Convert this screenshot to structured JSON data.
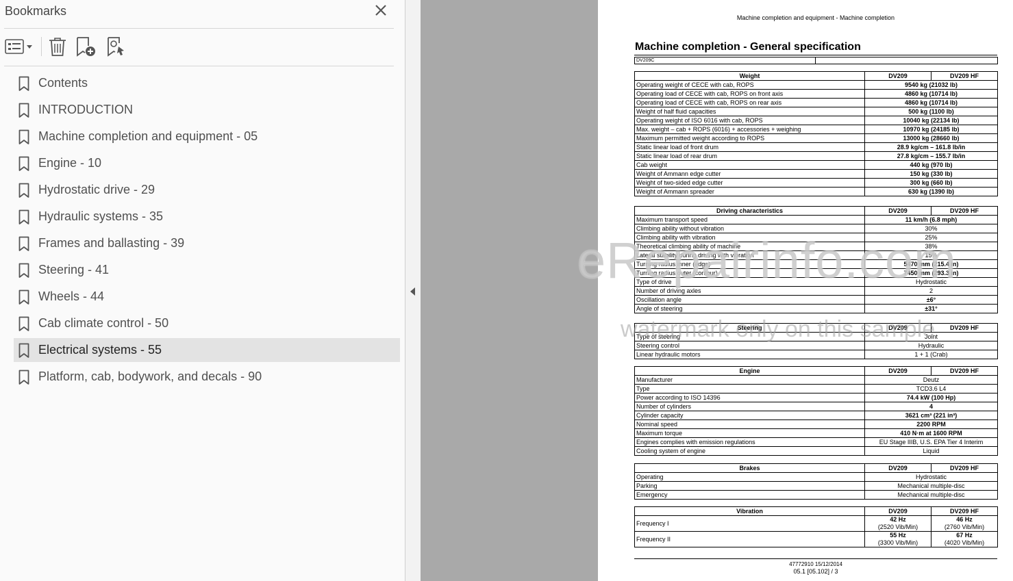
{
  "panel": {
    "title": "Bookmarks",
    "bookmarks": [
      "Contents",
      "INTRODUCTION",
      "Machine completion and equipment - 05",
      "Engine - 10",
      "Hydrostatic drive - 29",
      "Hydraulic systems - 35",
      "Frames and ballasting - 39",
      "Steering - 41",
      "Wheels - 44",
      "Cab climate control - 50",
      "Electrical systems - 55",
      "Platform, cab, bodywork, and decals - 90"
    ],
    "selected_index": 10,
    "icons": [
      "options-menu-icon",
      "trash-icon",
      "add-bookmark-icon",
      "find-bookmark-icon",
      "close-icon",
      "collapse-arrow-icon",
      "bookmark-icon"
    ]
  },
  "doc": {
    "header": "Machine completion and equipment - Machine completion",
    "title": "Machine completion - General specification",
    "code": "DV209C",
    "col1": "DV209",
    "col2": "DV209 HF",
    "weight": {
      "heading": "Weight",
      "rows": [
        [
          "Operating weight of CECE with cab, ROPS",
          "9540 kg (21032 lb)"
        ],
        [
          "Operating load of CECE with cab, ROPS on front axis",
          "4860 kg (10714 lb)"
        ],
        [
          "Operating load of CECE with cab, ROPS on rear axis",
          "4860 kg (10714 lb)"
        ],
        [
          "Weight of half fluid capacities",
          "500 kg (1100 lb)"
        ],
        [
          "Operating weight of ISO 6016 with cab, ROPS",
          "10040 kg (22134 lb)"
        ],
        [
          "Max. weight – cab + ROPS (6016) + accessories + weighing",
          "10970 kg (24185 lb)"
        ],
        [
          "Maximum permitted weight according to ROPS",
          "13000 kg (28660 lb)"
        ],
        [
          "Static linear load of front drum",
          "28.9 kg/cm – 161.8 lb/in"
        ],
        [
          "Static linear load of rear drum",
          "27.8 kg/cm – 155.7 lb/in"
        ],
        [
          "Cab weight",
          "440 kg (970 lb)"
        ],
        [
          "Weight of Ammann edge cutter",
          "150 kg (330 lb)"
        ],
        [
          "Weight of two-sided edge cutter",
          "300 kg (660 lb)"
        ],
        [
          "Weight of Ammann spreader",
          "630 kg (1390 lb)"
        ]
      ]
    },
    "driving": {
      "heading": "Driving characteristics",
      "rows": [
        [
          "Maximum transport speed",
          "11 km/h (6.8 mph)",
          true
        ],
        [
          "Climbing ability without vibration",
          "30%",
          false
        ],
        [
          "Climbing ability with vibration",
          "25%",
          false
        ],
        [
          "Theoretical climbing ability of machine",
          "38%",
          false
        ],
        [
          "Lateral stability during driving with vibration",
          "15%",
          false
        ],
        [
          "Turning radius inner (edge)",
          "5470 mm (215.4 in)",
          true
        ],
        [
          "Turning radius outer (contour)",
          "7450 mm (293.3 in)",
          true
        ],
        [
          "Type of drive",
          "Hydrostatic",
          false
        ],
        [
          "Number of driving axles",
          "2",
          false
        ],
        [
          "Oscillation angle",
          "±6°",
          true
        ],
        [
          "Angle of steering",
          "±31°",
          true
        ]
      ]
    },
    "steering": {
      "heading": "Steering",
      "rows": [
        [
          "Type of steering",
          "Joint"
        ],
        [
          "Steering control",
          "Hydraulic"
        ],
        [
          "Linear hydraulic motors",
          "1 + 1 (Crab)"
        ]
      ]
    },
    "engine": {
      "heading": "Engine",
      "rows": [
        [
          "Manufacturer",
          "Deutz",
          false
        ],
        [
          "Type",
          "TCD3.6 L4",
          false
        ],
        [
          "Power according to ISO 14396",
          "74.4 kW (100 Hp)",
          true
        ],
        [
          "Number of cylinders",
          "4",
          true
        ],
        [
          "Cylinder capacity",
          "3621 cm³ (221 in³)",
          true
        ],
        [
          "Nominal speed",
          "2200 RPM",
          true
        ],
        [
          "Maximum torque",
          "410 N·m at 1600 RPM",
          true
        ],
        [
          "Engines complies with emission regulations",
          "EU Stage IIIB, U.S. EPA Tier 4 Interim",
          false
        ],
        [
          "Cooling system of engine",
          "Liquid",
          false
        ]
      ]
    },
    "brakes": {
      "heading": "Brakes",
      "rows": [
        [
          "Operating",
          "Hydrostatic"
        ],
        [
          "Parking",
          "Mechanical multiple-disc"
        ],
        [
          "Emergency",
          "Mechanical multiple-disc"
        ]
      ]
    },
    "vibration": {
      "heading": "Vibration",
      "rows": [
        {
          "label": "Frequency I",
          "a1": "42 Hz",
          "a2": "(2520 Vib/Min)",
          "b1": "46 Hz",
          "b2": "(2760 Vib/Min)"
        },
        {
          "label": "Frequency II",
          "a1": "55 Hz",
          "a2": "(3300 Vib/Min)",
          "b1": "67 Hz",
          "b2": "(4020 Vib/Min)"
        }
      ]
    },
    "footer_line1": "47772910 15/12/2014",
    "footer_line2": "05.1 [05.102] / 3",
    "watermark_1": "eRepairinfo.com",
    "watermark_2": "watermark only on this sample"
  }
}
